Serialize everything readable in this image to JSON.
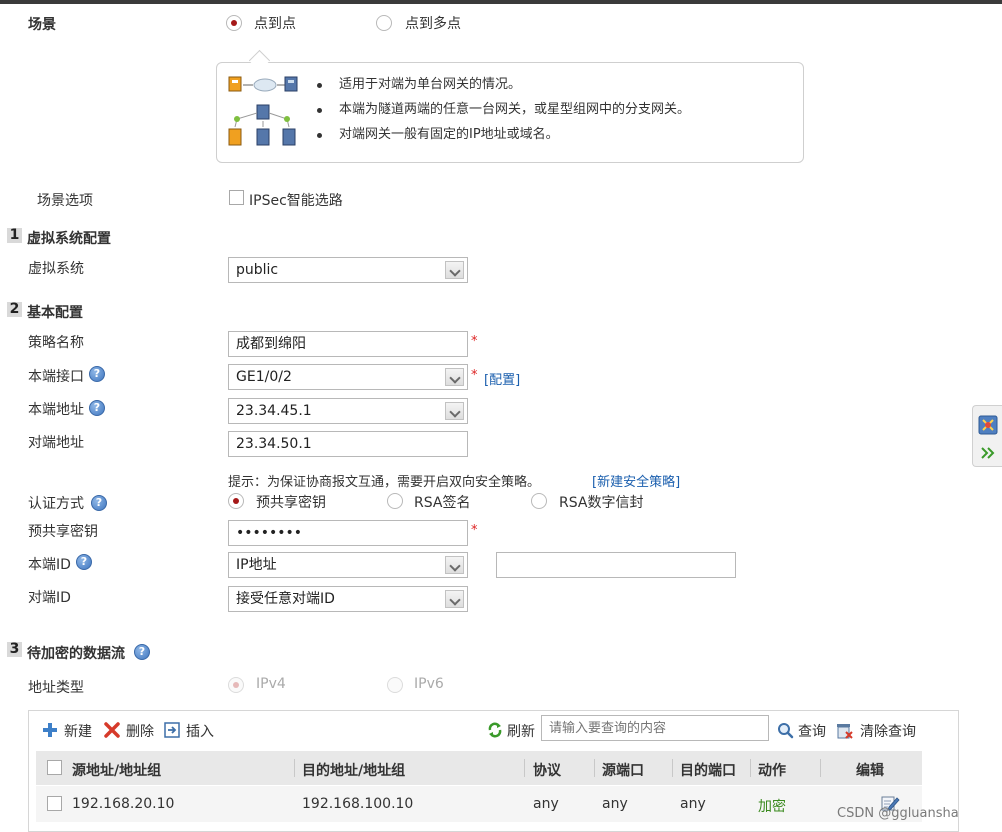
{
  "scene": {
    "label": "场景",
    "options": [
      {
        "label": "点到点",
        "selected": true
      },
      {
        "label": "点到多点",
        "selected": false
      }
    ],
    "tips": [
      "适用于对端为单台网关的情况。",
      "本端为隧道两端的任意一台网关，或星型组网中的分支网关。",
      "对端网关一般有固定的IP地址或域名。"
    ]
  },
  "scene_option": {
    "label": "场景选项",
    "checkbox_label": "IPSec智能选路",
    "checked": false
  },
  "section1": {
    "num": "1",
    "title": "虚拟系统配置",
    "vsys_label": "虚拟系统",
    "vsys_value": "public"
  },
  "section2": {
    "num": "2",
    "title": "基本配置",
    "policy_name_label": "策略名称",
    "policy_name_value": "成都到绵阳",
    "local_if_label": "本端接口",
    "local_if_value": "GE1/0/2",
    "config_link": "[配置]",
    "local_addr_label": "本端地址",
    "local_addr_value": "23.34.45.1",
    "peer_addr_label": "对端地址",
    "peer_addr_value": "23.34.50.1",
    "hint": "提示：为保证协商报文互通，需要开启双向安全策略。",
    "new_policy_link": "[新建安全策略]",
    "auth_label": "认证方式",
    "auth_options": [
      {
        "label": "预共享密钥",
        "selected": true
      },
      {
        "label": "RSA签名",
        "selected": false
      },
      {
        "label": "RSA数字信封",
        "selected": false
      }
    ],
    "psk_label": "预共享密钥",
    "psk_value": "••••••••",
    "local_id_label": "本端ID",
    "local_id_value": "IP地址",
    "local_id_extra": "",
    "peer_id_label": "对端ID",
    "peer_id_value": "接受任意对端ID",
    "required_mark": "*",
    "help_glyph": "?"
  },
  "section3": {
    "num": "3",
    "title": "待加密的数据流",
    "addr_type_label": "地址类型",
    "addr_type_options": [
      {
        "label": "IPv4",
        "selected": true
      },
      {
        "label": "IPv6",
        "selected": false
      }
    ]
  },
  "toolbar": {
    "new": "新建",
    "delete": "删除",
    "insert": "插入",
    "refresh": "刷新",
    "search_placeholder": "请输入要查询的内容",
    "query": "查询",
    "clear_query": "清除查询"
  },
  "table": {
    "headers": [
      "源地址/地址组",
      "目的地址/地址组",
      "协议",
      "源端口",
      "目的端口",
      "动作",
      "编辑"
    ],
    "rows": [
      {
        "src": "192.168.20.10",
        "dst": "192.168.100.10",
        "protocol": "any",
        "src_port": "any",
        "dst_port": "any",
        "action": "加密"
      }
    ]
  },
  "watermark": "CSDN @ggluansha",
  "colors": {
    "action_green": "#3a8a1e",
    "link_blue": "#1b5fae",
    "radio_red": "#a51818"
  }
}
